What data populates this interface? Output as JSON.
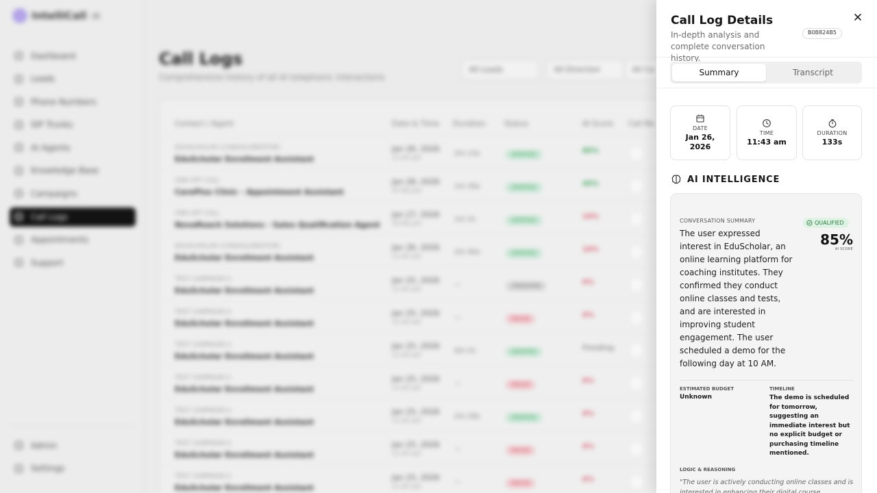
{
  "background": {
    "brand": {
      "name": "IntelliCall",
      "badge": "AI"
    },
    "nav": [
      {
        "label": "Dashboard",
        "icon": "dashboard-icon"
      },
      {
        "label": "Leads",
        "icon": "users-icon"
      },
      {
        "label": "Phone Numbers",
        "icon": "hash-icon"
      },
      {
        "label": "SIP Trunks",
        "icon": "server-icon"
      },
      {
        "label": "AI Agents",
        "icon": "bot-icon"
      },
      {
        "label": "Knowledge Base",
        "icon": "database-icon"
      },
      {
        "label": "Campaigns",
        "icon": "megaphone-icon"
      },
      {
        "label": "Call Logs",
        "icon": "phone-icon",
        "active": true
      },
      {
        "label": "Appointments",
        "icon": "calendar-icon"
      },
      {
        "label": "Support",
        "icon": "support-icon"
      }
    ],
    "nav_bottom": [
      {
        "label": "Admin",
        "icon": "shield-icon"
      },
      {
        "label": "Settings",
        "icon": "gear-icon"
      }
    ],
    "page_title": "Call Logs",
    "page_subtitle": "Comprehensive history of all AI telephonic interactions",
    "filters": [
      "All Leads",
      "All Direction",
      "All Ca"
    ],
    "table_headers": [
      "Contact / Agent",
      "Date & Time",
      "Duration",
      "Status",
      "AI Score",
      "Call Re"
    ],
    "rows": [
      {
        "contact": "EDUSCHOLAR (CONSOLUREDTOR)",
        "agent": "EduScholar Enrollment Assistant",
        "date": "Jan 26, 2026",
        "time": "11:43 am",
        "duration": "2m 13s",
        "status": "VERIFIED",
        "status_color": "green",
        "score": "85%",
        "score_color": "#3aa75b"
      },
      {
        "contact": "ONE-OFF CALL",
        "agent": "CarePlus Clinic - Appointment Assistant",
        "date": "Jan 28, 2026",
        "time": "07:45 pm",
        "duration": "1m 30s",
        "status": "VERIFIED",
        "status_color": "green",
        "score": "40%",
        "score_color": "#3aa75b"
      },
      {
        "contact": "ONE-OFF CALL",
        "agent": "NovaReach Solutions - Sales Qualification Agent",
        "date": "Jan 27, 2026",
        "time": "10:45 pm",
        "duration": "1m 2s",
        "status": "VERIFIED",
        "status_color": "green",
        "score": "10%",
        "score_color": "#e05a6a"
      },
      {
        "contact": "EDUSCHOLAR (CONSOLUREDTOR)",
        "agent": "EduScholar Enrollment Assistant",
        "date": "Jan 26, 2026",
        "time": "11:43 am",
        "duration": "2m 40s",
        "status": "VERIFIED",
        "status_color": "green",
        "score": "10%",
        "score_color": "#e05a6a"
      },
      {
        "contact": "TEST CAMPAIGN A",
        "agent": "EduScholar Enrollment Assistant",
        "date": "Jan 25, 2026",
        "time": "11:43 am",
        "duration": "—",
        "status": "UNKNOWN",
        "status_color": "gray",
        "score": "0%",
        "score_color": "#e05a6a"
      },
      {
        "contact": "TEST CAMPAIGN A",
        "agent": "EduScholar Enrollment Assistant",
        "date": "Jan 25, 2026",
        "time": "11:43 am",
        "duration": "—",
        "status": "FAILED",
        "status_color": "red",
        "score": "0%",
        "score_color": "#e05a6a"
      },
      {
        "contact": "TEST CAMPAIGN A",
        "agent": "EduScholar Enrollment Assistant",
        "date": "Jan 25, 2026",
        "time": "11:43 am",
        "duration": "0m 2s",
        "status": "VERIFIED",
        "status_color": "green",
        "score": "Pending",
        "score_color": "#999999"
      },
      {
        "contact": "TEST CAMPAIGN A",
        "agent": "EduScholar Enrollment Assistant",
        "date": "Jan 25, 2026",
        "time": "11:43 am",
        "duration": "—",
        "status": "FAILED",
        "status_color": "red",
        "score": "0%",
        "score_color": "#e05a6a"
      },
      {
        "contact": "TEST CAMPAIGN A",
        "agent": "EduScholar Enrollment Assistant",
        "date": "Jan 25, 2026",
        "time": "11:43 am",
        "duration": "2m 29s",
        "status": "VERIFIED",
        "status_color": "green",
        "score": "0%",
        "score_color": "#e05a6a"
      },
      {
        "contact": "TEST CAMPAIGN A",
        "agent": "EduScholar Enrollment Assistant",
        "date": "Jan 25, 2026",
        "time": "11:43 am",
        "duration": "—",
        "status": "FAILED",
        "status_color": "red",
        "score": "0%",
        "score_color": "#e05a6a"
      },
      {
        "contact": "TEST CAMPAIGN A",
        "agent": "EduScholar Enrollment Assistant",
        "date": "Jan 25, 2026",
        "time": "11:43 am",
        "duration": "—",
        "status": "FAILED",
        "status_color": "red",
        "score": "0%",
        "score_color": "#e05a6a"
      }
    ]
  },
  "drawer": {
    "title": "Call Log Details",
    "subtitle": "In-depth analysis and complete conversation history.",
    "id_badge": "B0B824B5",
    "close_icon": "close-icon",
    "tabs": [
      {
        "label": "Summary",
        "selected": true
      },
      {
        "label": "Transcript",
        "selected": false
      }
    ],
    "cards": {
      "date": {
        "label": "DATE",
        "value": "Jan 26, 2026",
        "icon": "calendar-icon"
      },
      "time": {
        "label": "TIME",
        "value": "11:43 am",
        "icon": "clock-icon"
      },
      "duration": {
        "label": "DURATION",
        "value": "133s",
        "icon": "timer-icon"
      }
    },
    "ai": {
      "title": "AI INTELLIGENCE",
      "icon": "brain-icon",
      "summary_label": "CONVERSATION SUMMARY",
      "summary": "The user expressed interest in EduScholar, an online learning platform for coaching institutes. They confirmed they conduct online classes and tests, and are interested in improving student engagement. The user scheduled a demo for the following day at 10 AM.",
      "qualified_label": "QUALIFIED",
      "score": "85%",
      "score_label": "AI SCORE",
      "budget_label": "ESTIMATED BUDGET",
      "budget": "Unknown",
      "timeline_label": "TIMELINE",
      "timeline": "The demo is scheduled for tomorrow, suggesting an immediate interest but no explicit budget or purchasing timeline mentioned.",
      "reasoning_label": "LOGIC & REASONING",
      "reasoning": "\"The user is actively conducting online classes and is interested in enhancing their digital course"
    },
    "colors": {
      "qualified_bg": "#dff3e4",
      "qualified_text": "#2a7a3f"
    }
  }
}
